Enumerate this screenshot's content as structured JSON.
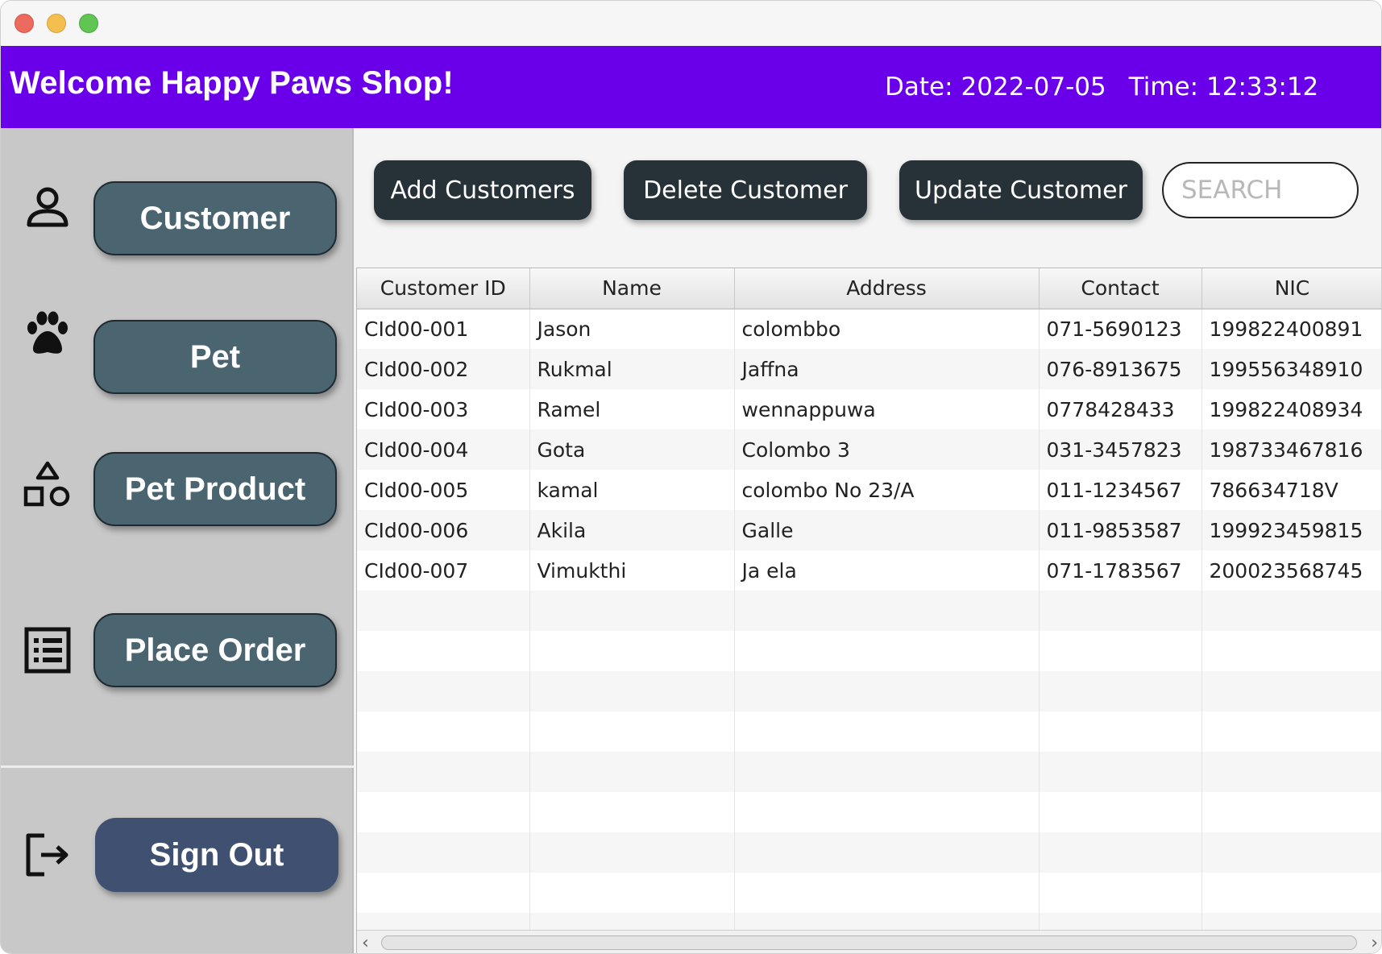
{
  "header": {
    "title": "Welcome Happy Paws Shop!",
    "date_label": "Date:",
    "date_value": "2022-07-05",
    "time_label": "Time:",
    "time_value": "12:33:12"
  },
  "sidebar": {
    "items": [
      {
        "label": "Customer",
        "icon": "person-icon"
      },
      {
        "label": "Pet",
        "icon": "paw-icon"
      },
      {
        "label": "Pet Product",
        "icon": "shapes-icon"
      },
      {
        "label": "Place Order",
        "icon": "list-icon"
      }
    ],
    "sign_out": {
      "label": "Sign Out",
      "icon": "logout-icon"
    }
  },
  "toolbar": {
    "add_label": "Add Customers",
    "delete_label": "Delete Customer",
    "update_label": "Update Customer",
    "search_placeholder": "SEARCH"
  },
  "table": {
    "columns": [
      "Customer ID",
      "Name",
      "Address",
      "Contact",
      "NIC"
    ],
    "rows": [
      [
        "CId00-001",
        "Jason",
        "colombbo",
        "071-5690123",
        "199822400891"
      ],
      [
        "CId00-002",
        "Rukmal",
        "Jaffna",
        "076-8913675",
        "199556348910"
      ],
      [
        "CId00-003",
        "Ramel",
        "wennappuwa",
        "0778428433",
        "199822408934"
      ],
      [
        "CId00-004",
        "Gota",
        "Colombo 3",
        "031-3457823",
        "198733467816"
      ],
      [
        "CId00-005",
        "kamal",
        "colombo No 23/A",
        "011-1234567",
        "786634718V"
      ],
      [
        "CId00-006",
        "Akila",
        "Galle",
        "011-9853587",
        "199923459815"
      ],
      [
        "CId00-007",
        "Vimukthi",
        "Ja ela",
        "071-1783567",
        "200023568745"
      ]
    ]
  },
  "colors": {
    "header_bg": "#6a00ea",
    "nav_button_bg": "#4a6470",
    "action_button_bg": "#263238",
    "signout_bg": "#3f5070",
    "sidebar_bg": "#c8c8c8"
  }
}
